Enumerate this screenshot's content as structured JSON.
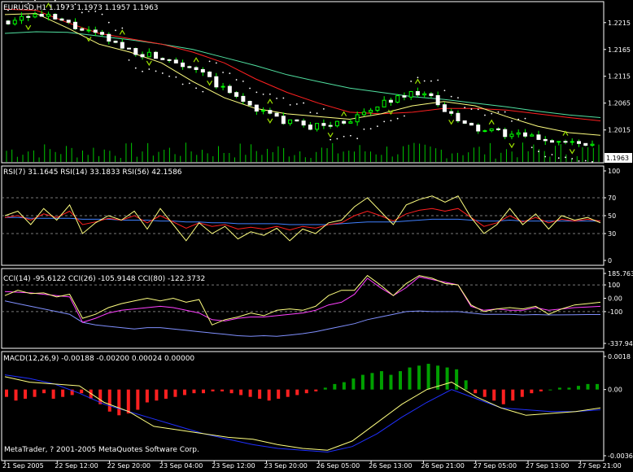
{
  "colors": {
    "background": "#000000",
    "frame": "#ffffff",
    "grid": "#7a7a7a",
    "bull_candle": "#000000",
    "bull_outline": "#00ff00",
    "bear_candle": "#ffffff",
    "wick": "#00ff00",
    "volume": "#00c800",
    "sar": "#ffffff",
    "ma_fast": "#ffff80",
    "ma_mid": "#ff2020",
    "ma_slow": "#50e0a0",
    "fractal": "#9ce000",
    "price_tag_bg": "#ffffff",
    "price_tag_text": "#000000",
    "rsi7": "#ffff80",
    "rsi14": "#ff2020",
    "rsi56": "#4080ff",
    "cci14": "#ffff80",
    "cci26": "#ff40ff",
    "cci80": "#8090ff",
    "macd_main": "#ffff80",
    "macd_signal": "#2030ff",
    "macd_hist_up": "#00a000",
    "macd_hist_down": "#ff2020"
  },
  "chart_data": [
    {
      "panel": "price",
      "type": "candlestick",
      "title": "EURUSD,H1  1.1973 1.1973 1.1957 1.1963",
      "symbol": "EURUSD",
      "timeframe": "H1",
      "ohlc_last": [
        1.1973,
        1.1973,
        1.1957,
        1.1963
      ],
      "ylim": [
        1.1963,
        1.2245
      ],
      "y_ticks": [
        "1.2215",
        "1.2165",
        "1.2115",
        "1.2065",
        "1.2015"
      ],
      "y_tick_values": [
        1.2215,
        1.2165,
        1.2115,
        1.2065,
        1.2015
      ],
      "current_price": "1.1963",
      "current_price_value": 1.1963,
      "x_labels": [
        "21 Sep 2005",
        "22 Sep 12:00",
        "22 Sep 20:00",
        "23 Sep 04:00",
        "23 Sep 12:00",
        "23 Sep 20:00",
        "26 Sep 05:00",
        "26 Sep 13:00",
        "26 Sep 21:00",
        "27 Sep 05:00",
        "27 Sep 13:00",
        "27 Sep 21:00"
      ],
      "price_anchors": [
        1.2218,
        1.223,
        1.2226,
        1.2215,
        1.22,
        1.2188,
        1.217,
        1.2158,
        1.2152,
        1.2143,
        1.2128,
        1.21,
        1.2078,
        1.2058,
        1.204,
        1.2028,
        1.2022,
        1.2024,
        1.2033,
        1.2045,
        1.2068,
        1.208,
        1.2088,
        1.2055,
        1.2028,
        1.2015,
        1.201,
        1.2005,
        1.2,
        1.1995,
        1.199,
        1.1985
      ],
      "series": [
        {
          "name": "MA fast",
          "values": [
            1.223,
            1.2232,
            1.2205,
            1.2175,
            1.216,
            1.214,
            1.2105,
            1.2075,
            1.2055,
            1.2045,
            1.204,
            1.2035,
            1.2045,
            1.206,
            1.2068,
            1.206,
            1.204,
            1.2022,
            1.201,
            1.2005
          ]
        },
        {
          "name": "MA mid",
          "values": [
            1.224,
            1.2238,
            1.2215,
            1.2195,
            1.2185,
            1.2175,
            1.216,
            1.214,
            1.211,
            1.2085,
            1.2065,
            1.2048,
            1.2045,
            1.2048,
            1.2055,
            1.2055,
            1.2052,
            1.2045,
            1.2038,
            1.2032
          ]
        },
        {
          "name": "MA slow",
          "values": [
            1.2195,
            1.2198,
            1.2197,
            1.219,
            1.2183,
            1.2175,
            1.2165,
            1.215,
            1.2135,
            1.2118,
            1.2105,
            1.2093,
            1.2085,
            1.2077,
            1.2072,
            1.2065,
            1.2058,
            1.205,
            1.2043,
            1.2038
          ]
        }
      ],
      "volume_bars": 110
    },
    {
      "panel": "rsi",
      "type": "line",
      "title": "RSI(7) 31.1645  RSI(14) 33.1833  RSI(56) 42.1586",
      "ylim": [
        0,
        100
      ],
      "y_ticks": [
        "100",
        "70",
        "50",
        "30",
        "0"
      ],
      "y_tick_values": [
        100,
        70,
        50,
        30,
        0
      ],
      "levels": [
        70,
        50,
        30
      ],
      "series": [
        {
          "name": "RSI(7)",
          "last": 31.1645,
          "values": [
            50,
            55,
            40,
            58,
            45,
            62,
            30,
            42,
            50,
            45,
            55,
            35,
            58,
            40,
            22,
            42,
            30,
            38,
            24,
            32,
            28,
            36,
            22,
            35,
            30,
            42,
            45,
            60,
            70,
            55,
            40,
            62,
            68,
            72,
            65,
            72,
            48,
            30,
            40,
            58,
            40,
            52,
            35,
            50,
            45,
            48,
            42
          ]
        },
        {
          "name": "RSI(14)",
          "last": 33.1833,
          "values": [
            48,
            50,
            45,
            52,
            48,
            55,
            40,
            43,
            47,
            45,
            50,
            42,
            50,
            43,
            36,
            42,
            38,
            40,
            35,
            37,
            35,
            38,
            34,
            38,
            36,
            40,
            42,
            50,
            55,
            50,
            44,
            52,
            56,
            58,
            55,
            58,
            48,
            38,
            42,
            50,
            43,
            48,
            42,
            46,
            44,
            46,
            44
          ]
        },
        {
          "name": "RSI(56)",
          "last": 42.1586,
          "values": [
            48,
            48,
            47,
            47,
            47,
            47,
            46,
            46,
            46,
            45,
            45,
            45,
            44,
            44,
            43,
            43,
            42,
            42,
            41,
            41,
            41,
            41,
            40,
            40,
            40,
            40,
            41,
            42,
            43,
            43,
            43,
            44,
            45,
            46,
            46,
            46,
            45,
            44,
            44,
            45,
            44,
            44,
            44,
            44,
            44,
            44,
            44
          ]
        }
      ]
    },
    {
      "panel": "cci",
      "type": "line",
      "title": "CCI(14) -95.6122  CCI(26) -105.9148  CCI(80) -122.3732",
      "ylim": [
        -337.94,
        185.76
      ],
      "y_ticks": [
        "185.763",
        "100",
        "0.00",
        "-100",
        "-337.94"
      ],
      "y_tick_values": [
        185.763,
        100,
        0,
        -100,
        -337.94
      ],
      "levels": [
        100,
        -100
      ],
      "series": [
        {
          "name": "CCI(14)",
          "last": -95.6122,
          "values": [
            20,
            60,
            35,
            40,
            10,
            30,
            -150,
            -120,
            -70,
            -40,
            -20,
            0,
            -20,
            0,
            -30,
            -10,
            -200,
            -160,
            -140,
            -110,
            -130,
            -90,
            -80,
            -90,
            -60,
            20,
            60,
            60,
            170,
            100,
            20,
            110,
            170,
            150,
            110,
            100,
            -50,
            -100,
            -80,
            -70,
            -80,
            -60,
            -120,
            -80,
            -50,
            -40,
            -30
          ]
        },
        {
          "name": "CCI(26)",
          "last": -105.9148,
          "values": [
            50,
            45,
            40,
            30,
            20,
            10,
            -180,
            -150,
            -110,
            -90,
            -80,
            -70,
            -60,
            -70,
            -90,
            -110,
            -160,
            -170,
            -150,
            -140,
            -140,
            -130,
            -120,
            -110,
            -90,
            -50,
            -30,
            30,
            150,
            80,
            20,
            80,
            160,
            140,
            120,
            100,
            -60,
            -90,
            -80,
            -90,
            -90,
            -70,
            -90,
            -80,
            -70,
            -65,
            -60
          ]
        },
        {
          "name": "CCI(80)",
          "last": -122.3732,
          "values": [
            -20,
            -40,
            -60,
            -80,
            -100,
            -120,
            -180,
            -200,
            -210,
            -220,
            -230,
            -220,
            -220,
            -230,
            -240,
            -250,
            -260,
            -270,
            -280,
            -285,
            -280,
            -285,
            -275,
            -265,
            -250,
            -230,
            -210,
            -190,
            -160,
            -140,
            -120,
            -100,
            -95,
            -100,
            -100,
            -100,
            -110,
            -120,
            -120,
            -120,
            -125,
            -122,
            -125,
            -124,
            -123,
            -122,
            -122
          ]
        }
      ]
    },
    {
      "panel": "macd",
      "type": "bar",
      "title": "MACD(12,26,9) -0.00188 -0.00200 0.00024 0.00000",
      "ylim": [
        -0.0036,
        0.0018
      ],
      "y_ticks": [
        "0.0018",
        "0.00",
        "-0.0036"
      ],
      "y_tick_values": [
        0.0018,
        0,
        -0.0036
      ],
      "histogram": [
        -0.0004,
        -0.0006,
        -0.0005,
        -0.0004,
        -0.0002,
        -0.0005,
        -0.0004,
        -0.0003,
        -0.0002,
        -0.0005,
        -0.0008,
        -0.0012,
        -0.0014,
        -0.0013,
        -0.0011,
        -0.0007,
        -0.0006,
        -0.0005,
        -0.0004,
        -0.0003,
        -0.0002,
        -0.0002,
        -0.0001,
        -0.0001,
        -0.0002,
        -0.0003,
        -0.0004,
        -0.0005,
        -0.0006,
        -0.0005,
        -0.0004,
        -0.0003,
        -0.0002,
        -0.0001,
        0.0001,
        0.0003,
        0.0004,
        0.0006,
        0.0008,
        0.0009,
        0.001,
        0.0008,
        0.001,
        0.0012,
        0.0013,
        0.0014,
        0.0013,
        0.0012,
        0.0011,
        0.0005,
        -0.0002,
        -0.0004,
        -0.0006,
        -0.0008,
        -0.0006,
        -0.0004,
        -0.0002,
        -0.0001,
        0.0,
        0.0001,
        0.0001,
        0.0002,
        0.0003,
        0.0003
      ],
      "series": [
        {
          "name": "MACD",
          "last": -0.00188,
          "values": [
            0.0007,
            0.0004,
            0.0003,
            0.0002,
            -0.0007,
            -0.0012,
            -0.002,
            -0.0022,
            -0.0024,
            -0.0026,
            -0.0027,
            -0.003,
            -0.0032,
            -0.0033,
            -0.0028,
            -0.0018,
            -0.0008,
            0.0,
            0.0004,
            -0.0004,
            -0.001,
            -0.0014,
            -0.0013,
            -0.0012,
            -0.001
          ]
        },
        {
          "name": "Signal",
          "last": -0.002,
          "values": [
            0.0008,
            0.0006,
            0.0003,
            -0.0002,
            -0.0008,
            -0.0012,
            -0.0016,
            -0.002,
            -0.0024,
            -0.0027,
            -0.003,
            -0.0032,
            -0.0033,
            -0.0034,
            -0.0031,
            -0.0024,
            -0.0015,
            -0.0007,
            0.0,
            -0.0005,
            -0.001,
            -0.0011,
            -0.0012,
            -0.0012,
            -0.0011
          ]
        }
      ]
    }
  ],
  "footer": {
    "copyright": "MetaTrader, ? 2001-2005 MetaQuotes Software Corp."
  }
}
